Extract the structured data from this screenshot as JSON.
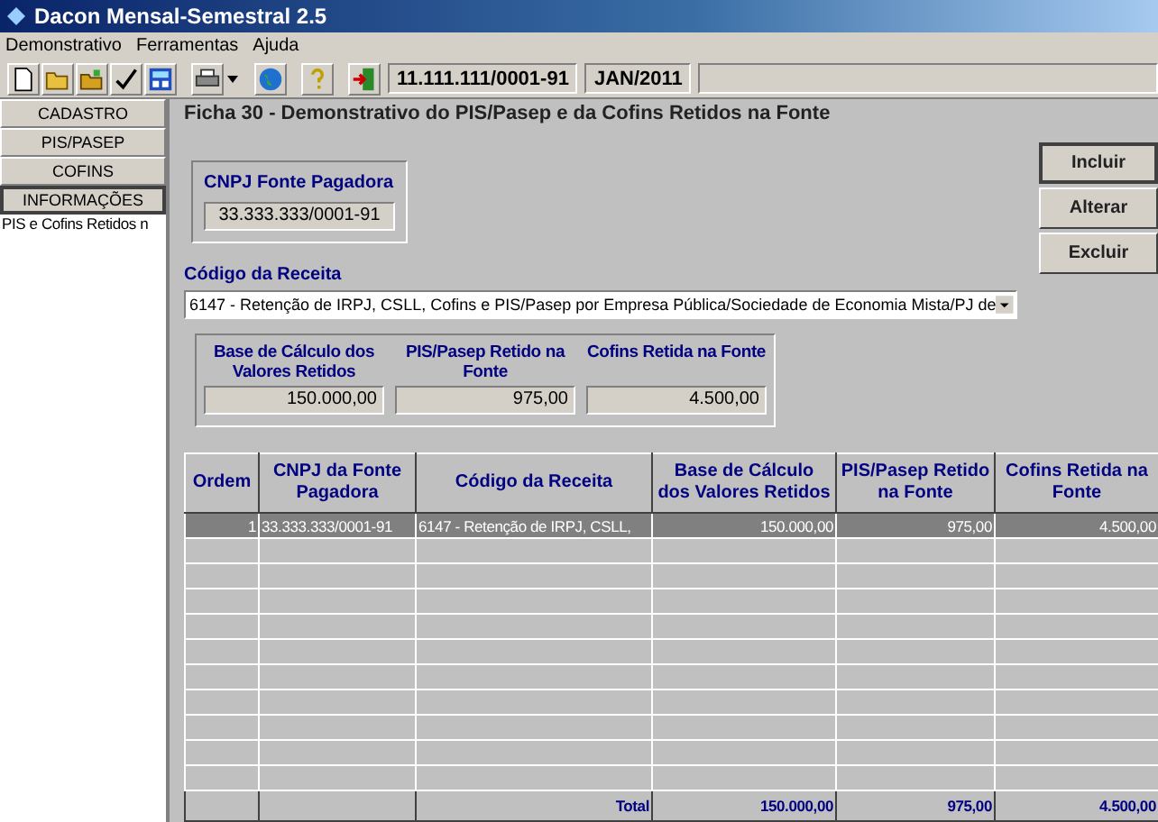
{
  "window": {
    "title": "Dacon Mensal-Semestral 2.5"
  },
  "menu": [
    "Demonstrativo",
    "Ferramentas",
    "Ajuda"
  ],
  "toolbar": {
    "cnpj": "11.111.111/0001-91",
    "period": "JAN/2011"
  },
  "sidebar": {
    "buttons": [
      {
        "label": "CADASTRO",
        "selected": false
      },
      {
        "label": "PIS/PASEP",
        "selected": false
      },
      {
        "label": "COFINS",
        "selected": false
      },
      {
        "label": "INFORMAÇÕES",
        "selected": true
      }
    ],
    "items": [
      "PIS e Cofins Retidos n"
    ]
  },
  "form": {
    "title": "Ficha 30 - Demonstrativo do PIS/Pasep e da Cofins Retidos na Fonte",
    "cnpj_label": "CNPJ Fonte Pagadora",
    "cnpj_value": "33.333.333/0001-91",
    "receita_label": "Código da Receita",
    "receita_value": "6147 - Retenção de IRPJ, CSLL, Cofins e PIS/Pasep por Empresa Pública/Sociedade de Economia Mista/PJ de",
    "values": [
      {
        "label": "Base de Cálculo dos Valores Retidos",
        "value": "150.000,00"
      },
      {
        "label": "PIS/Pasep Retido na Fonte",
        "value": "975,00"
      },
      {
        "label": "Cofins Retida na Fonte",
        "value": "4.500,00"
      }
    ],
    "buttons": [
      "Incluir",
      "Alterar",
      "Excluir"
    ]
  },
  "table": {
    "columns": [
      "Ordem",
      "CNPJ da Fonte Pagadora",
      "Código da Receita",
      "Base de Cálculo dos Valores Retidos",
      "PIS/Pasep Retido na Fonte",
      "Cofins Retida na Fonte"
    ],
    "rows": [
      {
        "selected": true,
        "cells": [
          "1",
          "33.333.333/0001-91",
          "6147 - Retenção de IRPJ, CSLL,",
          "150.000,00",
          "975,00",
          "4.500,00"
        ]
      }
    ],
    "total_label": "Total",
    "totals": [
      "150.000,00",
      "975,00",
      "4.500,00"
    ]
  }
}
